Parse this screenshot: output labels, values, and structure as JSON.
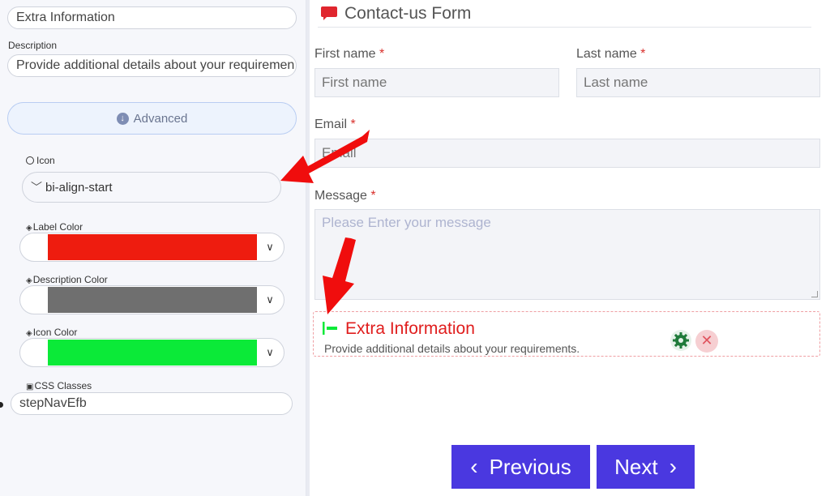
{
  "panel": {
    "label_field_value": "Extra Information",
    "description_label": "Description",
    "description_value": "Provide additional details about your requiremen",
    "advanced_label": "Advanced",
    "icon_label": "Icon",
    "icon_select_value": "bi-align-start",
    "label_color_label": "Label Color",
    "label_color": "#ee1c0f",
    "description_color_label": "Description Color",
    "description_color": "#6f6f6f",
    "icon_color_label": "Icon Color",
    "icon_color": "#0bea38",
    "css_classes_label": "CSS Classes",
    "css_classes_value": "stepNavEfb"
  },
  "form": {
    "title": "Contact-us Form",
    "first_name_label": "First name",
    "first_name_placeholder": "First name",
    "last_name_label": "Last name",
    "last_name_placeholder": "Last name",
    "email_label": "Email",
    "email_placeholder": "Email",
    "message_label": "Message",
    "message_placeholder": "Please Enter your message",
    "required_mark": "*",
    "extra_title": "Extra Information",
    "extra_description": "Provide additional details about your requirements.",
    "previous_label": "Previous",
    "next_label": "Next"
  },
  "colors": {
    "accent": "#4a38e0",
    "required": "#d9302c",
    "extra_title": "#e01d1d",
    "arrow": "#f00d0d"
  }
}
